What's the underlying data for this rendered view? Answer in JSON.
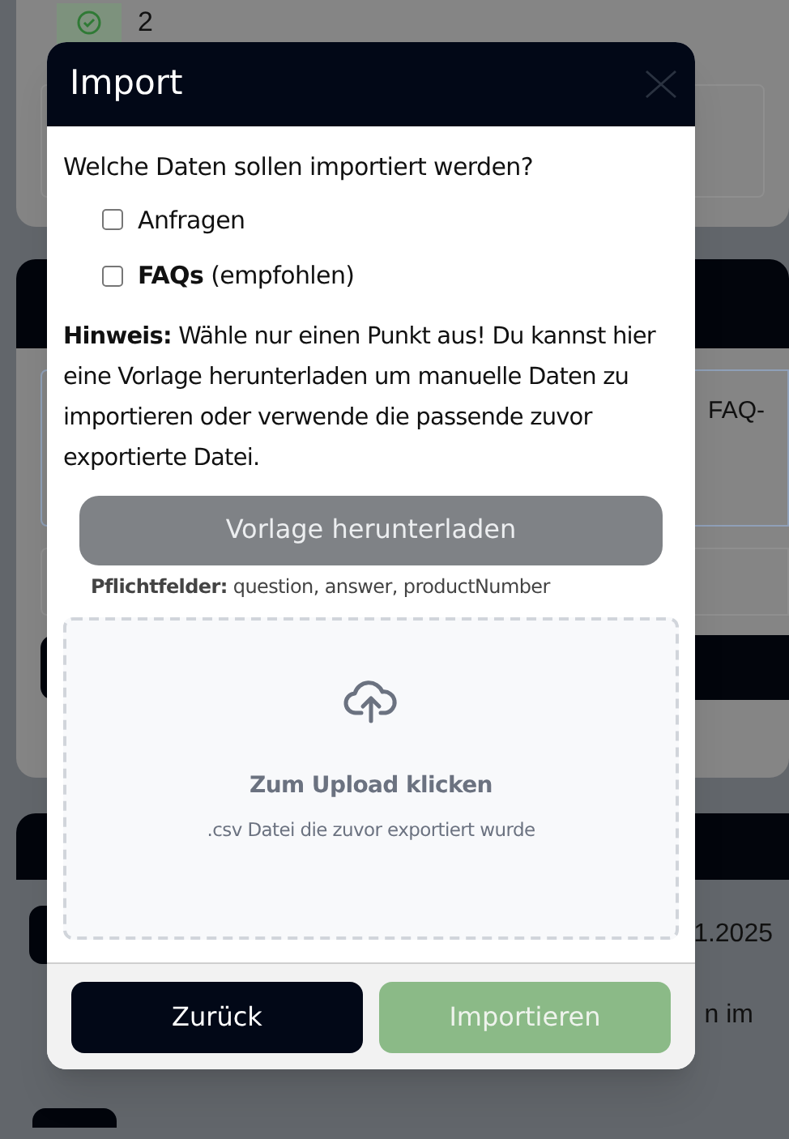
{
  "background_page": {
    "count": "2",
    "row_text": "FAQ-",
    "date": "1.2025",
    "paragraph_fragment": "n im"
  },
  "dialog": {
    "title": "Import",
    "question": "Welche Daten sollen importiert werden?",
    "options": [
      {
        "label": "Anfragen",
        "checked": false
      },
      {
        "label": "**FAQs** (empfohlen)",
        "checked": false
      }
    ],
    "hint": "**Hinweis:** Wähle nur einen Punkt aus! Du kannst hier eine Vorlage herunterladen um manuelle Daten zu importieren oder verwende die passende zuvor exportierte Datei.",
    "download_button": {
      "label": "Vorlage herunterladen",
      "disabled": true
    },
    "required_fields": "**Pflichtfelder:** question, answer, productNumber",
    "dropzone": {
      "title": "Zum Upload klicken",
      "subtitle": ".csv Datei die zuvor exportiert wurde"
    },
    "buttons": [
      {
        "label": "Zurück",
        "kind": "secondary",
        "disabled": false
      },
      {
        "label": "Importieren",
        "kind": "primary",
        "disabled": true
      }
    ]
  }
}
